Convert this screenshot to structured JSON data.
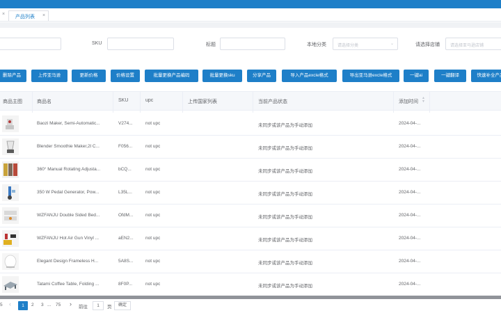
{
  "tabs": {
    "close_left": "×",
    "active_tab": "产品列表",
    "active_close": "×"
  },
  "filters": {
    "sku_label": "SKU",
    "title_label": "标题",
    "category_label": "本地分类",
    "category_placeholder": "请选择分类",
    "shop_label": "请选择店铺",
    "shop_placeholder": "请选择亚马逊店铺"
  },
  "buttons": [
    "删除产品",
    "上传亚马逊",
    "更新价格",
    "价格设置",
    "批量更换产品编码",
    "批量更换sku",
    "分享产品",
    "导入产品excle格式",
    "导出亚马逊excle格式",
    "一键ai",
    "一键翻译",
    "快速补全产品"
  ],
  "table": {
    "headers": {
      "image": "商品主图",
      "name": "商品名",
      "sku": "SKU",
      "upc": "upc",
      "upload_countries": "上传国家列表",
      "status": "当前产品状态",
      "added_time": "添加时间"
    },
    "rows": [
      {
        "name": "Baozi Maker, Semi-Automatic...",
        "sku": "V274...",
        "upc": "not upc",
        "status": "未同步或该产品为手动添加",
        "time": "2024-04-..."
      },
      {
        "name": "Blender Smoothie Maker,2l C...",
        "sku": "F056...",
        "upc": "not upc",
        "status": "未同步或该产品为手动添加",
        "time": "2024-04-..."
      },
      {
        "name": "360° Manual Rotating Adjusta...",
        "sku": "bCQ...",
        "upc": "not upc",
        "status": "未同步或该产品为手动添加",
        "time": "2024-04-..."
      },
      {
        "name": "350 W Pedal Generator, Pow...",
        "sku": "L35L...",
        "upc": "not upc",
        "status": "未同步或该产品为手动添加",
        "time": "2024-04-..."
      },
      {
        "name": "WZFANJU Double Sided Bed...",
        "sku": "OfdM...",
        "upc": "not upc",
        "status": "未同步或该产品为手动添加",
        "time": "2024-04-..."
      },
      {
        "name": "WZFANJU Hot Air Gun Vinyl ...",
        "sku": "aEN2...",
        "upc": "not upc",
        "status": "未同步或该产品为手动添加",
        "time": "2024-04-..."
      },
      {
        "name": "Elegant Design Frameless H...",
        "sku": "5A8S...",
        "upc": "not upc",
        "status": "未同步或该产品为手动添加",
        "time": "2024-04-..."
      },
      {
        "name": "Tatami Coffee Table, Folding ...",
        "sku": "8F0P...",
        "upc": "not upc",
        "status": "未同步或该产品为手动添加",
        "time": "2024-04-..."
      }
    ]
  },
  "pagination": {
    "left_digit": "5",
    "prev": "‹",
    "pages": [
      "1",
      "2",
      "3"
    ],
    "ellipsis": "...",
    "last_page": "75",
    "next": "›",
    "goto_label": "前往",
    "goto_value": "1",
    "page_unit": "页",
    "confirm": "确定"
  },
  "colors": {
    "primary": "#1e7fc8",
    "scrollbar": "#909399"
  }
}
